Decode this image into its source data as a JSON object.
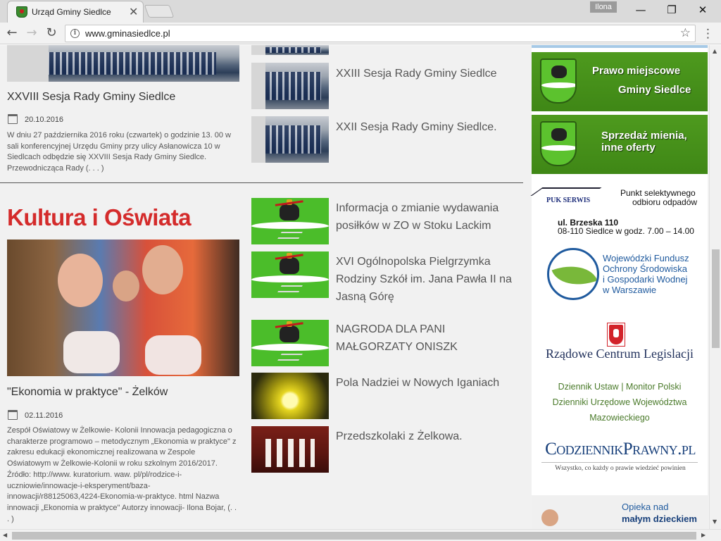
{
  "browser": {
    "tab_title": "Urząd Gminy Siedlce",
    "tab_close": "✕",
    "profile_name": "Ilona",
    "url": "www.gminasiedlce.pl",
    "back": "←",
    "forward": "→",
    "reload": "↻",
    "star": "☆",
    "menu": "⋮",
    "minimize": "—",
    "maximize": "❐",
    "close": "✕"
  },
  "top_article": {
    "title": "XXVIII Sesja Rady Gminy Siedlce",
    "date": "20.10.2016",
    "excerpt": "W dniu 27 października 2016 roku (czwartek) o godzinie 13. 00 w sali konferencyjnej Urzędu Gminy przy ulicy Asłanowicza 10 w Siedlcach odbędzie się XXVIII Sesja Rady Gminy Siedlce. Przewodnicząca Rady (. . . )"
  },
  "top_side_items": [
    {
      "title": "XXIII Sesja Rady Gminy Siedlce"
    },
    {
      "title": "XXII Sesja Rady Gminy Siedlce."
    }
  ],
  "section": {
    "title": "Kultura i Oświata"
  },
  "section_article": {
    "title": "\"Ekonomia w praktyce\" - Żelków",
    "date": "02.11.2016",
    "excerpt": "Zespół Oświatowy w Żelkowie- Kolonii Innowacja pedagogiczna o charakterze programowo – metodycznym „Ekonomia w praktyce\" z zakresu edukacji ekonomicznej realizowana w Zespole Oświatowym w Żelkowie-Kolonii w roku szkolnym 2016/2017. Źródło: http://www. kuratorium. waw. pl/pl/rodzice-i-uczniowie/innowacje-i-eksperyment/baza-innowacji/r88125063,4224-Ekonomia-w-praktyce. html Nazwa innowacji „Ekonomia w praktyce\" Autorzy innowacji- Ilona Bojar, (. . . )"
  },
  "section_side_items": [
    {
      "title": "Informacja o zmianie wydawania posiłków w ZO w Stoku Lackim"
    },
    {
      "title": "XVI Ogólnopolska Pielgrzymka Rodziny Szkół im. Jana Pawła II na Jasną Górę"
    },
    {
      "title": "NAGRODA DLA PANI MAŁGORZATY ONISZK"
    },
    {
      "title": "Pola Nadziei w Nowych Iganiach"
    },
    {
      "title": "Przedszkolaki z Żelkowa."
    }
  ],
  "sidebar": {
    "banner1_line1": "Prawo miejscowe",
    "banner1_line2": "Gminy Siedlce",
    "banner2_line1": "Sprzedaż mienia,",
    "banner2_line2": "inne oferty",
    "puk_logo": "PUK SERWIS",
    "puk_line1": "Punkt selektywnego",
    "puk_line2": "odbioru odpadów",
    "puk_address": "ul. Brzeska 110",
    "puk_hours": "08-110 Siedlce w godz. 7.00 – 14.00",
    "wfos_line1": "Wojewódzki Fundusz",
    "wfos_line2": "Ochrony Środowiska",
    "wfos_line3": "i Gospodarki Wodnej",
    "wfos_line4": "w Warszawie",
    "rcl": "Rządowe Centrum Legislacji",
    "link_dziennik_ustaw": "Dziennik Ustaw",
    "link_separator": "|",
    "link_monitor_polski": "Monitor Polski",
    "link_dzienniki_line1": "Dzienniki Urzędowe Województwa",
    "link_dzienniki_line2": "Mazowieckiego",
    "cpr_title": "CodziennikPrawny.pl",
    "cpr_sub": "Wszystko, co każdy o prawie wiedzieć powinien",
    "opieka_line1": "Opieka nad",
    "opieka_line2": "małym dzieckiem"
  },
  "colors": {
    "section_title": "#d42b2b",
    "banner_green": "#4e9a1e",
    "link_green": "#4a7a2a",
    "wfos_blue": "#1f5a9e"
  }
}
